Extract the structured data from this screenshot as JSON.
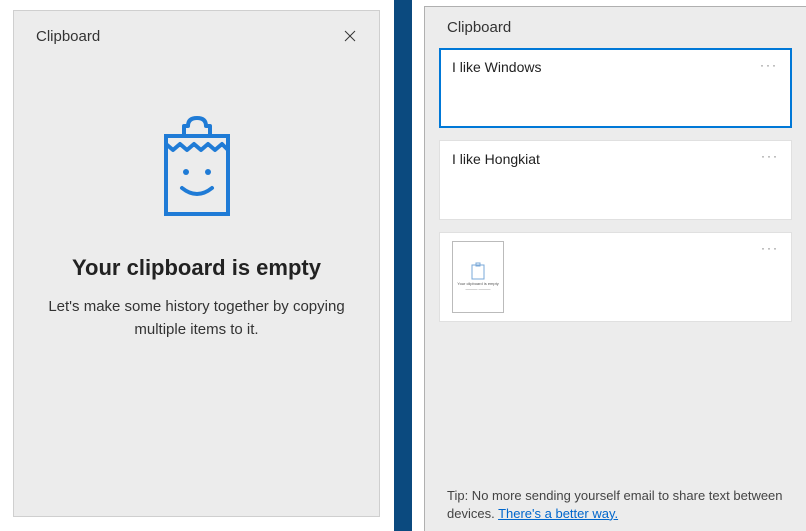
{
  "left": {
    "title": "Clipboard",
    "empty_heading": "Your clipboard is empty",
    "empty_subtext": "Let's make some history together by copying multiple items to it."
  },
  "right": {
    "title": "Clipboard",
    "items": [
      {
        "type": "text",
        "text": "I like Windows",
        "selected": true
      },
      {
        "type": "text",
        "text": "I like Hongkiat",
        "selected": false
      },
      {
        "type": "image",
        "selected": false
      }
    ],
    "tip_prefix": "Tip: No more sending yourself email to share text between devices.  ",
    "tip_link": "There's a better way."
  },
  "colors": {
    "accent": "#0078d7",
    "divider": "#0b4a7f"
  }
}
